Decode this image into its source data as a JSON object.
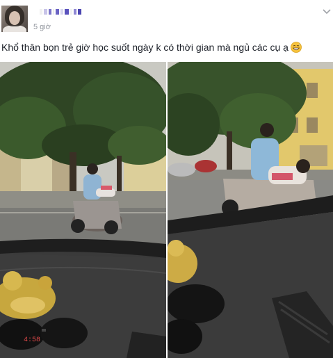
{
  "post": {
    "author_blurred": true,
    "timestamp": "5 giờ",
    "caption": "Khổ thân bọn trẻ giờ học suốt ngày k có thời gian mà ngủ các cụ ạ",
    "caption_emoji": "grinning-sweat-emoji",
    "menu_icon": "chevron-down-icon"
  },
  "photos": {
    "left": {
      "overlay_text": "4:58"
    },
    "right": {}
  },
  "colors": {
    "name_pixels": [
      "#f0f0f0",
      "#c8c4e8",
      "#7b74c9",
      "#eeeeee",
      "#6a63c3",
      "#d8d6f0",
      "#5a52bd",
      "#f2f2f2",
      "#8f88d4",
      "#4a44b0"
    ],
    "timestamp": "#90949c",
    "text": "#1d2129"
  }
}
